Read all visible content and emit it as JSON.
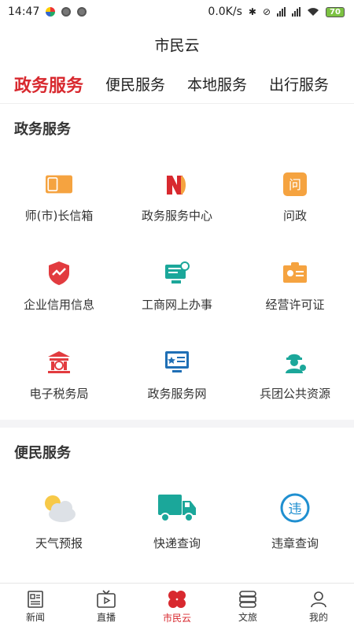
{
  "status_bar": {
    "time": "14:47",
    "speed": "0.0K/s",
    "battery": "70"
  },
  "header": {
    "title": "市民云"
  },
  "tabs": [
    {
      "label": "政务服务",
      "active": true
    },
    {
      "label": "便民服务"
    },
    {
      "label": "本地服务"
    },
    {
      "label": "出行服务"
    }
  ],
  "sections": [
    {
      "title": "政务服务",
      "items": [
        {
          "label": "师(市)长信箱",
          "icon": "mailbox-icon"
        },
        {
          "label": "政务服务中心",
          "icon": "n-logo-icon"
        },
        {
          "label": "问政",
          "icon": "question-icon"
        },
        {
          "label": "企业信用信息",
          "icon": "shield-icon"
        },
        {
          "label": "工商网上办事",
          "icon": "computer-icon"
        },
        {
          "label": "经营许可证",
          "icon": "license-icon"
        },
        {
          "label": "电子税务局",
          "icon": "tax-bureau-icon"
        },
        {
          "label": "政务服务网",
          "icon": "monitor-icon"
        },
        {
          "label": "兵团公共资源",
          "icon": "soldier-icon"
        }
      ]
    },
    {
      "title": "便民服务",
      "items": [
        {
          "label": "天气预报",
          "icon": "weather-icon"
        },
        {
          "label": "快递查询",
          "icon": "truck-icon"
        },
        {
          "label": "违章查询",
          "icon": "violation-icon"
        }
      ]
    }
  ],
  "bottom_nav": [
    {
      "label": "新闻",
      "icon": "news-icon"
    },
    {
      "label": "直播",
      "icon": "tv-icon"
    },
    {
      "label": "市民云",
      "icon": "clover-icon",
      "active": true
    },
    {
      "label": "文旅",
      "icon": "travel-icon"
    },
    {
      "label": "我的",
      "icon": "user-icon"
    }
  ],
  "colors": {
    "accent": "#d8292f",
    "orange": "#f5a340",
    "teal": "#1ba79a"
  }
}
